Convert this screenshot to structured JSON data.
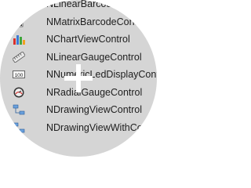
{
  "list": {
    "items": [
      {
        "label": "NLinearBarcodeControl",
        "icon": "barcode-icon"
      },
      {
        "label": "NMatrixBarcodeControl",
        "icon": "matrix-barcode-icon"
      },
      {
        "label": "NChartViewControl",
        "icon": "chart-icon"
      },
      {
        "label": "NLinearGaugeControl",
        "icon": "linear-gauge-icon"
      },
      {
        "label": "NNumericLedDisplayControl",
        "icon": "led-display-icon"
      },
      {
        "label": "NRadialGaugeControl",
        "icon": "radial-gauge-icon"
      },
      {
        "label": "NDrawingViewControl",
        "icon": "drawing-view-icon"
      },
      {
        "label": "NDrawingViewWithCommandBarsControl",
        "icon": "drawing-view-commandbars-icon"
      },
      {
        "label": "",
        "icon": "partial-icon"
      }
    ],
    "led_icon_text": "100"
  },
  "colors": {
    "lens_background": "#d5d5d5",
    "text": "#202020",
    "crosshair": "#ffffff"
  }
}
